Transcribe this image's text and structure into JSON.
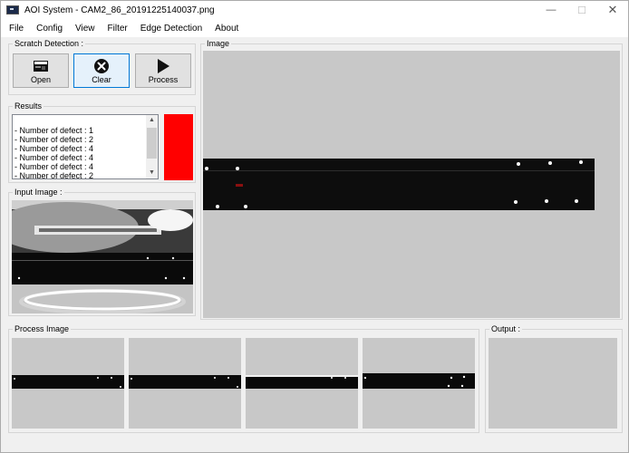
{
  "window": {
    "title": "AOI System - CAM2_86_20191225140037.png",
    "minimize_icon": "minimize-icon",
    "maximize_icon": "maximize-icon",
    "close_icon": "close-icon"
  },
  "menu": [
    "File",
    "Config",
    "View",
    "Filter",
    "Edge Detection",
    "About"
  ],
  "scratch_detection": {
    "title": "Scratch Detection :",
    "buttons": [
      {
        "label": "Open",
        "icon": "open-image-icon"
      },
      {
        "label": "Clear",
        "icon": "clear-x-icon"
      },
      {
        "label": "Process",
        "icon": "play-icon"
      }
    ]
  },
  "results": {
    "title": "Results",
    "items": [
      "- Number of defect : 1",
      "- Number of defect : 2",
      "- Number of defect : 4",
      "- Number of defect : 4",
      "- Number of defect : 4",
      "- Number of defect : 2"
    ],
    "indicator_color": "#ff0000"
  },
  "input_image": {
    "title": "Input Image :"
  },
  "image": {
    "title": "Image"
  },
  "process_image": {
    "title": "Process Image"
  },
  "output": {
    "title": "Output :"
  }
}
